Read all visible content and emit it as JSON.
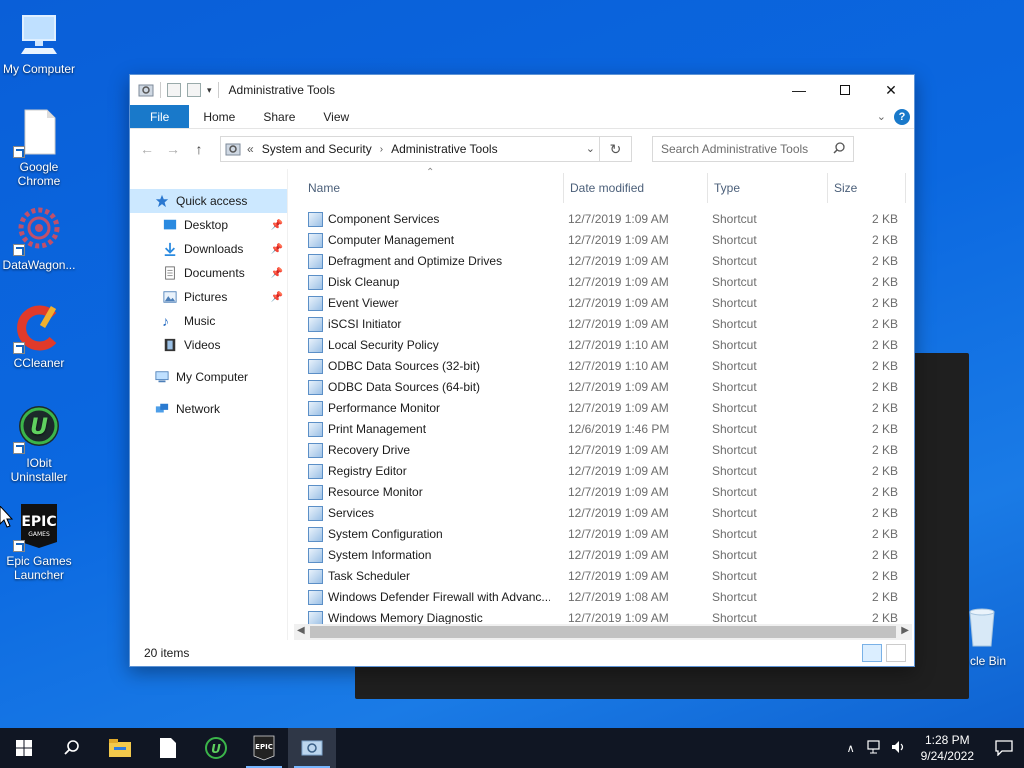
{
  "desktop": {
    "icons": [
      {
        "label": "My Computer"
      },
      {
        "label": "Google Chrome"
      },
      {
        "label": "DataWagon..."
      },
      {
        "label": "CCleaner"
      },
      {
        "label": "IObit Uninstaller"
      },
      {
        "label": "Epic Games Launcher"
      },
      {
        "label": "cle Bin"
      }
    ]
  },
  "window": {
    "title": "Administrative Tools",
    "ribbon": {
      "file": "File",
      "home": "Home",
      "share": "Share",
      "view": "View"
    },
    "address": {
      "part1": "System and Security",
      "part2": "Administrative Tools",
      "overflow": "«"
    },
    "search_placeholder": "Search Administrative Tools",
    "nav": {
      "quick_access": "Quick access",
      "desktop": "Desktop",
      "downloads": "Downloads",
      "documents": "Documents",
      "pictures": "Pictures",
      "music": "Music",
      "videos": "Videos",
      "my_computer": "My Computer",
      "network": "Network"
    },
    "columns": {
      "name": "Name",
      "date": "Date modified",
      "type": "Type",
      "size": "Size"
    },
    "files": [
      {
        "name": "Component Services",
        "date": "12/7/2019 1:09 AM",
        "type": "Shortcut",
        "size": "2 KB"
      },
      {
        "name": "Computer Management",
        "date": "12/7/2019 1:09 AM",
        "type": "Shortcut",
        "size": "2 KB"
      },
      {
        "name": "Defragment and Optimize Drives",
        "date": "12/7/2019 1:09 AM",
        "type": "Shortcut",
        "size": "2 KB"
      },
      {
        "name": "Disk Cleanup",
        "date": "12/7/2019 1:09 AM",
        "type": "Shortcut",
        "size": "2 KB"
      },
      {
        "name": "Event Viewer",
        "date": "12/7/2019 1:09 AM",
        "type": "Shortcut",
        "size": "2 KB"
      },
      {
        "name": "iSCSI Initiator",
        "date": "12/7/2019 1:09 AM",
        "type": "Shortcut",
        "size": "2 KB"
      },
      {
        "name": "Local Security Policy",
        "date": "12/7/2019 1:10 AM",
        "type": "Shortcut",
        "size": "2 KB"
      },
      {
        "name": "ODBC Data Sources (32-bit)",
        "date": "12/7/2019 1:10 AM",
        "type": "Shortcut",
        "size": "2 KB"
      },
      {
        "name": "ODBC Data Sources (64-bit)",
        "date": "12/7/2019 1:09 AM",
        "type": "Shortcut",
        "size": "2 KB"
      },
      {
        "name": "Performance Monitor",
        "date": "12/7/2019 1:09 AM",
        "type": "Shortcut",
        "size": "2 KB"
      },
      {
        "name": "Print Management",
        "date": "12/6/2019 1:46 PM",
        "type": "Shortcut",
        "size": "2 KB"
      },
      {
        "name": "Recovery Drive",
        "date": "12/7/2019 1:09 AM",
        "type": "Shortcut",
        "size": "2 KB"
      },
      {
        "name": "Registry Editor",
        "date": "12/7/2019 1:09 AM",
        "type": "Shortcut",
        "size": "2 KB"
      },
      {
        "name": "Resource Monitor",
        "date": "12/7/2019 1:09 AM",
        "type": "Shortcut",
        "size": "2 KB"
      },
      {
        "name": "Services",
        "date": "12/7/2019 1:09 AM",
        "type": "Shortcut",
        "size": "2 KB"
      },
      {
        "name": "System Configuration",
        "date": "12/7/2019 1:09 AM",
        "type": "Shortcut",
        "size": "2 KB"
      },
      {
        "name": "System Information",
        "date": "12/7/2019 1:09 AM",
        "type": "Shortcut",
        "size": "2 KB"
      },
      {
        "name": "Task Scheduler",
        "date": "12/7/2019 1:09 AM",
        "type": "Shortcut",
        "size": "2 KB"
      },
      {
        "name": "Windows Defender Firewall with Advanc...",
        "date": "12/7/2019 1:08 AM",
        "type": "Shortcut",
        "size": "2 KB"
      },
      {
        "name": "Windows Memory Diagnostic",
        "date": "12/7/2019 1:09 AM",
        "type": "Shortcut",
        "size": "2 KB"
      }
    ],
    "status": "20 items"
  },
  "taskbar": {
    "time": "1:28 PM",
    "date": "9/24/2022"
  },
  "colors": {
    "accent": "#1979ca",
    "selection": "#cce8ff",
    "taskbar": "#101623"
  }
}
